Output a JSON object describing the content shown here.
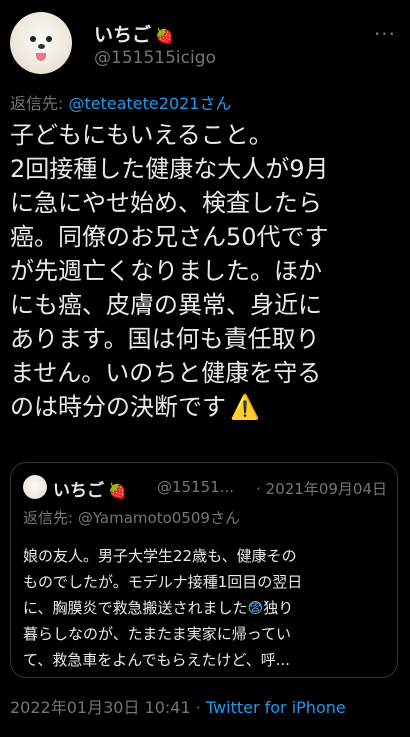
{
  "user": {
    "display_name": "いちご",
    "handle": "@151515icigo"
  },
  "reply": {
    "prefix": "返信先: ",
    "mention": "@teteatete2021さん"
  },
  "tweet": {
    "lines": [
      "子どもにもいえること。",
      "2回接種した健康な大人が9月",
      "に急にやせ始め、検査したら",
      "癌。同僚のお兄さん50代です",
      "が先週亡くなりました。ほか",
      "にも癌、皮膚の異常、身近に",
      "あります。国は何も責任取り",
      "ません。いのちと健康を守る",
      "のは時分の決断です"
    ],
    "warning_emoji": "⚠️"
  },
  "quote": {
    "display_name": "いちご",
    "handle": "@15151...",
    "date": "· 2021年09月04日",
    "reply_prefix": "返信先: ",
    "reply_mention": "@Yamamoto0509さん",
    "lines": [
      "娘の友人。男子大学生22歳も、健康その",
      "ものでしたが。モデルナ接種1回目の翌日",
      "に、胸膜炎で救急搬送されました",
      "暮らしなのが、たまたま実家に帰ってい",
      "て、救急車をよんでもらえたけど、呼..."
    ],
    "line3_after_emoji": "独り",
    "scared_emoji": "😨"
  },
  "footer": {
    "timestamp": "2022年01月30日 10:41 · ",
    "source": "Twitter for iPhone"
  },
  "strawberry_emoji": "🍓",
  "more_icon": "···"
}
